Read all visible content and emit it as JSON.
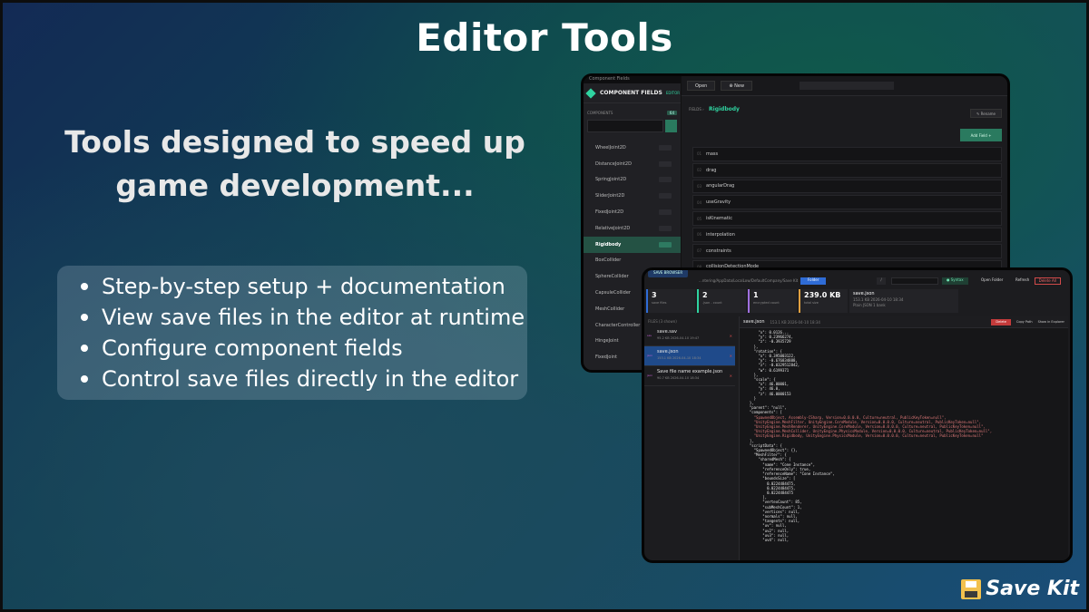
{
  "title": "Editor Tools",
  "tagline": "Tools designed to speed up game development...",
  "features": [
    "Step-by-step setup + documentation",
    "View save files in the editor at runtime",
    "Configure component fields",
    "Control save files directly in the editor"
  ],
  "brand": {
    "name": "Save Kit",
    "icon": "floppy-disk-icon"
  },
  "component_fields": {
    "window_strip": "Component Fields",
    "app_title": "COMPONENT FIELDS",
    "app_badge": "EDITOR",
    "components_label": "COMPONENTS",
    "components_count": "64",
    "open_label": "Open",
    "new_label": "New",
    "fields_label": "FIELDS",
    "selected_component": "Rigidbody",
    "rename_label": "Rename",
    "add_field_label": "Add Field",
    "components": [
      "WheelJoint2D",
      "DistanceJoint2D",
      "SpringJoint2D",
      "SliderJoint2D",
      "FixedJoint2D",
      "RelativeJoint2D",
      "Rigidbody",
      "BoxCollider",
      "SphereCollider",
      "CapsuleCollider",
      "MeshCollider",
      "CharacterController",
      "HingeJoint",
      "FixedJoint"
    ],
    "fields": [
      {
        "num": "01",
        "name": "mass"
      },
      {
        "num": "02",
        "name": "drag"
      },
      {
        "num": "03",
        "name": "angularDrag"
      },
      {
        "num": "04",
        "name": "useGravity"
      },
      {
        "num": "05",
        "name": "isKinematic"
      },
      {
        "num": "06",
        "name": "interpolation"
      },
      {
        "num": "07",
        "name": "constraints"
      },
      {
        "num": "08",
        "name": "collisionDetectionMode"
      }
    ]
  },
  "save_browser": {
    "tab_label": "SAVE BROWSER",
    "path": "...ntering/AppData/LocalLow/DefaultCompany/Save Kit",
    "folder_label": "Folder",
    "syntax_label": "Syntax",
    "open_folder_label": "Open Folder",
    "refresh_label": "Refresh",
    "delete_all_label": "Delete All",
    "stats": [
      {
        "value": "3",
        "label": "save files"
      },
      {
        "value": "2",
        "label": ".json - count"
      },
      {
        "value": "1",
        "label": "encrypted count"
      },
      {
        "value": "239.0 KB",
        "label": "total size"
      }
    ],
    "info_name": "save.json",
    "info_meta": "153.1 KB    2026-04-10 18:34",
    "info_type": "Plain JSON  1 bank",
    "files_head": "FILES (3 shown)",
    "files": [
      {
        "name": "save.sav",
        "meta": "95.2 KB   2026-04-10 19:47",
        "type": "sav",
        "active": false
      },
      {
        "name": "save.json",
        "meta": "153.1 KB   2026-04-10 18:34",
        "type": "json",
        "active": true
      },
      {
        "name": "Save file name example.json",
        "meta": "90.7 KB   2026-04-10 18:34",
        "type": "json",
        "active": false
      }
    ],
    "editor_file": "save.json",
    "editor_meta": "153.1 KB      2026-04-10 18:34",
    "delete_label": "Delete",
    "copy_path_label": "Copy Path",
    "show_explorer_label": "Show in Explorer",
    "code_lines": [
      "      \"x\": 0.0126...",
      "      \"y\": 0.23966274,",
      "      \"z\": -0.3935729",
      "    },",
      "    \"rotation\": {",
      "      \"x\": 0.395003122,",
      "      \"y\": -0.676834888,",
      "      \"z\": -0.0329512842,",
      "      \"w\": 0.6199371",
      "    },",
      "    \"scale\": {",
      "      \"x\": 46.00001,",
      "      \"y\": 46.0,",
      "      \"z\": 46.0000153",
      "    }",
      "  },",
      "  \"parent\": \"null\",",
      "  \"components\": [",
      "    \"SpawnedObject, Assembly-CSharp, Version=0.0.0.0, Culture=neutral, PublicKeyToken=null\",",
      "    \"UnityEngine.MeshFilter, UnityEngine.CoreModule, Version=0.0.0.0, Culture=neutral, PublicKeyToken=null\",",
      "    \"UnityEngine.MeshRenderer, UnityEngine.CoreModule, Version=0.0.0.0, Culture=neutral, PublicKeyToken=null\",",
      "    \"UnityEngine.MeshCollider, UnityEngine.PhysicsModule, Version=0.0.0.0, Culture=neutral, PublicKeyToken=null\",",
      "    \"UnityEngine.Rigidbody, UnityEngine.PhysicsModule, Version=0.0.0.0, Culture=neutral, PublicKeyToken=null\"",
      "  ],",
      "  \"scriptData\": {",
      "    \"SpawnedObject\": {},",
      "    \"MeshFilter\": {",
      "      \"sharedMesh\": {",
      "        \"name\": \"Cone Instance\",",
      "        \"referenceOnly\": true,",
      "        \"referenceName\": \"Cone Instance\",",
      "        \"boundsSize\": [",
      "          0.0224484475,",
      "          0.0224484475,",
      "          0.0224484475",
      "        ],",
      "        \"vertexCount\": 85,",
      "        \"subMeshCount\": 1,",
      "        \"vertices\": null,",
      "        \"normals\": null,",
      "        \"tangents\": null,",
      "        \"uv\": null,",
      "        \"uv2\": null,",
      "        \"uv3\": null,",
      "        \"uv4\": null,"
    ]
  }
}
